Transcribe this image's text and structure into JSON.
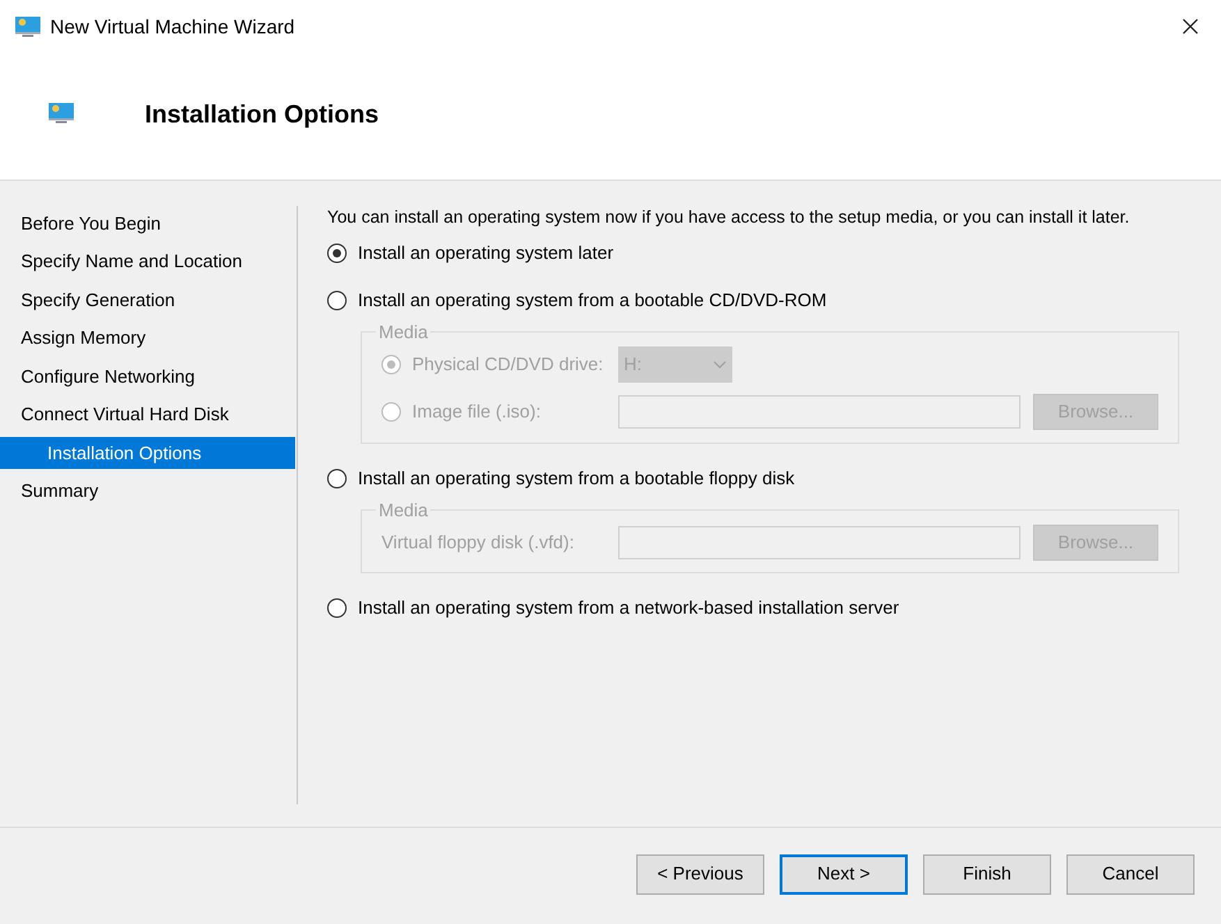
{
  "window": {
    "title": "New Virtual Machine Wizard"
  },
  "header": {
    "title": "Installation Options"
  },
  "sidebar": {
    "items": [
      {
        "label": "Before You Begin",
        "selected": false
      },
      {
        "label": "Specify Name and Location",
        "selected": false
      },
      {
        "label": "Specify Generation",
        "selected": false
      },
      {
        "label": "Assign Memory",
        "selected": false
      },
      {
        "label": "Configure Networking",
        "selected": false
      },
      {
        "label": "Connect Virtual Hard Disk",
        "selected": false
      },
      {
        "label": "Installation Options",
        "selected": true
      },
      {
        "label": "Summary",
        "selected": false
      }
    ]
  },
  "intro": "You can install an operating system now if you have access to the setup media, or you can install it later.",
  "options": [
    {
      "label": "Install an operating system later",
      "selected": true
    },
    {
      "label": "Install an operating system from a bootable CD/DVD-ROM",
      "selected": false,
      "media": {
        "title": "Media",
        "disabled": true,
        "rows": [
          {
            "kind": "radio-combo",
            "label": "Physical CD/DVD drive:",
            "selected": true,
            "value": "H:"
          },
          {
            "kind": "radio-file",
            "label": "Image file (.iso):",
            "selected": false,
            "button": "Browse..."
          }
        ]
      }
    },
    {
      "label": "Install an operating system from a bootable floppy disk",
      "selected": false,
      "media": {
        "title": "Media",
        "disabled": true,
        "rows": [
          {
            "kind": "file",
            "label": "Virtual floppy disk (.vfd):",
            "button": "Browse..."
          }
        ]
      }
    },
    {
      "label": "Install an operating system from a network-based installation server",
      "selected": false
    }
  ],
  "buttons": [
    {
      "label": "< Previous",
      "default": false
    },
    {
      "label": "Next >",
      "default": true
    },
    {
      "label": "Finish",
      "default": false
    },
    {
      "label": "Cancel",
      "default": false
    }
  ]
}
